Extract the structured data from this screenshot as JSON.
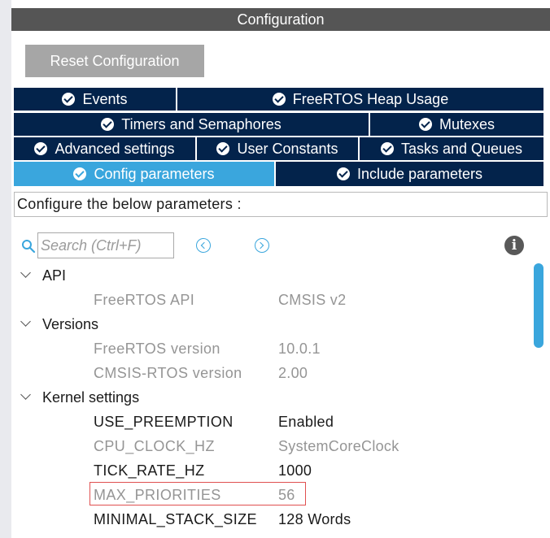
{
  "panel": {
    "title": "Configuration"
  },
  "toolbar": {
    "reset_label": "Reset Configuration"
  },
  "tabs": {
    "events": "Events",
    "heap_usage": "FreeRTOS Heap Usage",
    "timers": "Timers and Semaphores",
    "mutexes": "Mutexes",
    "advanced": "Advanced settings",
    "user_constants": "User Constants",
    "tasks_queues": "Tasks and Queues",
    "config_params": "Config parameters",
    "include_params": "Include parameters",
    "active": "Config parameters"
  },
  "description": "Configure the below parameters :",
  "search": {
    "placeholder": "Search (Ctrl+F)",
    "value": ""
  },
  "groups": {
    "api": {
      "label": "API",
      "params": [
        {
          "name": "FreeRTOS API",
          "value": "CMSIS v2",
          "enabled": false
        }
      ]
    },
    "versions": {
      "label": "Versions",
      "params": [
        {
          "name": "FreeRTOS version",
          "value": "10.0.1",
          "enabled": false
        },
        {
          "name": "CMSIS-RTOS version",
          "value": "2.00",
          "enabled": false
        }
      ]
    },
    "kernel": {
      "label": "Kernel settings",
      "params": [
        {
          "name": "USE_PREEMPTION",
          "value": "Enabled",
          "enabled": true
        },
        {
          "name": "CPU_CLOCK_HZ",
          "value": "SystemCoreClock",
          "enabled": false
        },
        {
          "name": "TICK_RATE_HZ",
          "value": "1000",
          "enabled": true
        },
        {
          "name": "MAX_PRIORITIES",
          "value": "56",
          "enabled": false,
          "highlighted": true
        },
        {
          "name": "MINIMAL_STACK_SIZE",
          "value": "128 Words",
          "enabled": true
        }
      ]
    }
  },
  "colors": {
    "tab_bg": "#03234b",
    "tab_active": "#3aa6dd",
    "title_bar": "#555555",
    "highlight": "#e05050"
  },
  "icons": [
    "check-circle-icon",
    "search-icon",
    "chevron-left-circle-icon",
    "chevron-right-circle-icon",
    "info-icon",
    "chevron-down-icon"
  ]
}
